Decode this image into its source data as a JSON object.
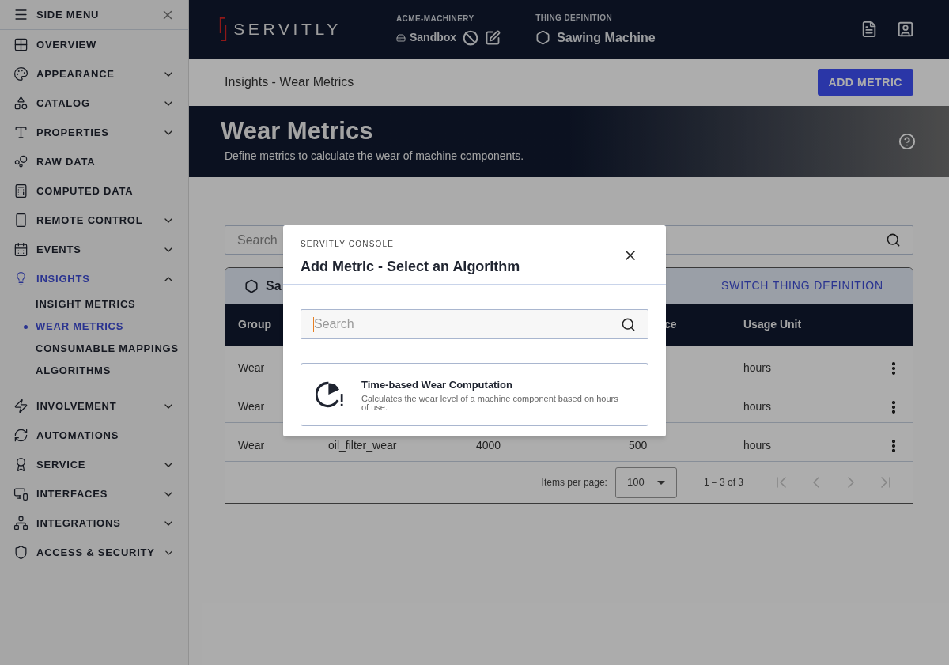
{
  "sidebar": {
    "title": "SIDE MENU",
    "items": [
      {
        "label": "OVERVIEW",
        "kind": "link",
        "selected": false
      },
      {
        "label": "APPEARANCE",
        "kind": "group",
        "expanded": false,
        "selected": false
      },
      {
        "label": "CATALOG",
        "kind": "group",
        "expanded": false,
        "selected": false
      },
      {
        "label": "PROPERTIES",
        "kind": "group",
        "expanded": false,
        "selected": false
      },
      {
        "label": "RAW DATA",
        "kind": "link",
        "selected": false
      },
      {
        "label": "COMPUTED DATA",
        "kind": "link",
        "selected": false
      },
      {
        "label": "REMOTE CONTROL",
        "kind": "group",
        "expanded": false,
        "selected": false
      },
      {
        "label": "EVENTS",
        "kind": "group",
        "expanded": false,
        "selected": false
      },
      {
        "label": "INSIGHTS",
        "kind": "group",
        "expanded": true,
        "selected": true,
        "children": [
          {
            "label": "INSIGHT METRICS",
            "selected": false
          },
          {
            "label": "WEAR METRICS",
            "selected": true
          },
          {
            "label": "CONSUMABLE MAPPINGS",
            "selected": false
          },
          {
            "label": "ALGORITHMS",
            "selected": false
          }
        ]
      },
      {
        "label": "INVOLVEMENT",
        "kind": "group",
        "expanded": false,
        "selected": false
      },
      {
        "label": "AUTOMATIONS",
        "kind": "link",
        "selected": false
      },
      {
        "label": "SERVICE",
        "kind": "group",
        "expanded": false,
        "selected": false
      },
      {
        "label": "INTERFACES",
        "kind": "group",
        "expanded": false,
        "selected": false
      },
      {
        "label": "INTEGRATIONS",
        "kind": "group",
        "expanded": false,
        "selected": false
      },
      {
        "label": "ACCESS & SECURITY",
        "kind": "group",
        "expanded": false,
        "selected": false
      }
    ]
  },
  "header": {
    "logo": "SERVITLY",
    "tenant_label": "ACME-MACHINERY",
    "tenant": "Sandbox",
    "thing_label": "THING DEFINITION",
    "thing": "Sawing Machine"
  },
  "toolbar": {
    "breadcrumb": "Insights - Wear Metrics",
    "button": "ADD METRIC"
  },
  "banner": {
    "title": "Wear Metrics",
    "subtitle": "Define metrics to calculate the wear of machine components."
  },
  "search": {
    "placeholder": "Search"
  },
  "table": {
    "thing": "Sa",
    "switch_link": "SWITCH THING DEFINITION",
    "columns": {
      "group": "Group",
      "column_4": "ce",
      "usage_unit": "Usage Unit"
    },
    "rows": [
      {
        "group": "Wear",
        "usage_unit": "hours"
      },
      {
        "group": "Wear",
        "usage_unit": "hours"
      },
      {
        "group": "Wear",
        "column_2": "oil_filter_wear",
        "column_3": "4000",
        "column_4": "500",
        "usage_unit": "hours"
      }
    ]
  },
  "paginator": {
    "label": "Items per page:",
    "page_size": "100",
    "range": "1 – 3 of 3"
  },
  "modal": {
    "eyebrow": "SERVITLY CONSOLE",
    "title": "Add Metric - Select an Algorithm",
    "search": {
      "placeholder": "Search",
      "focused": true
    },
    "algorithms": [
      {
        "title": "Time-based Wear Computation",
        "description": "Calculates the wear level of a machine component based on hours of use."
      }
    ]
  }
}
